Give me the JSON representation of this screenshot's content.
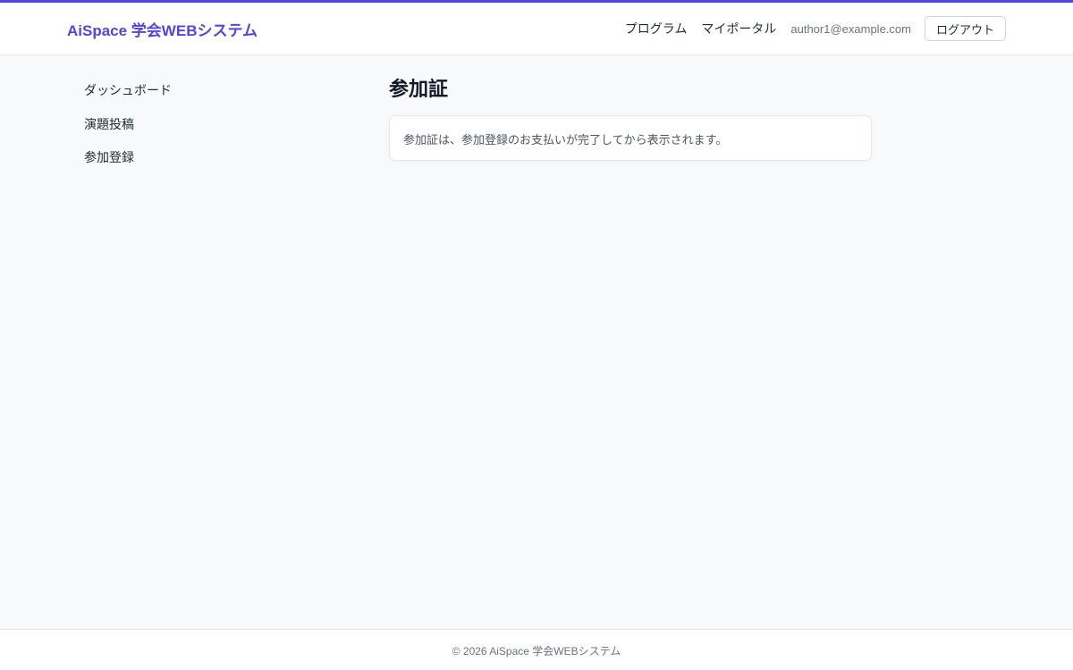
{
  "header": {
    "brand": "AiSpace 学会WEBシステム",
    "nav": [
      {
        "label": "プログラム"
      },
      {
        "label": "マイポータル"
      }
    ],
    "user_email": "author1@example.com",
    "logout_label": "ログアウト"
  },
  "sidebar": {
    "items": [
      {
        "label": "ダッシュボード"
      },
      {
        "label": "演題投稿"
      },
      {
        "label": "参加登録"
      }
    ]
  },
  "main": {
    "title": "参加証",
    "notice": "参加証は、参加登録のお支払いが完了してから表示されます。"
  },
  "footer": {
    "text": "© 2026 AiSpace 学会WEBシステム"
  },
  "colors": {
    "accent": "#4f46e5",
    "background": "#f8f9fb"
  }
}
